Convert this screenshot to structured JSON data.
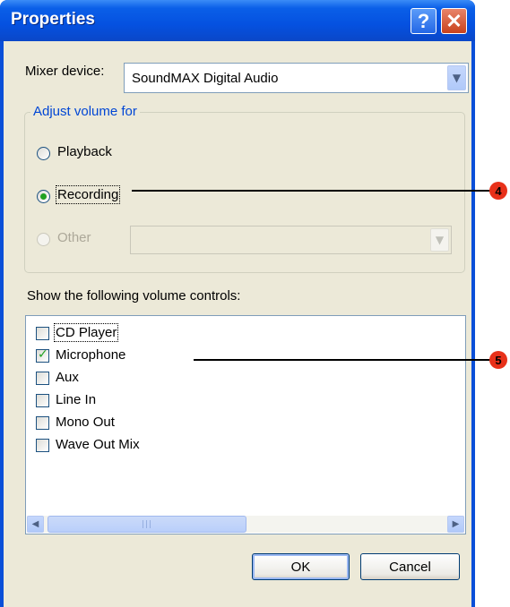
{
  "window": {
    "title": "Properties",
    "help_glyph": "?",
    "close_glyph": "✕"
  },
  "mixer": {
    "label": "Mixer device:",
    "selected": "SoundMAX Digital Audio"
  },
  "adjust_group": {
    "title": "Adjust volume for",
    "options": [
      {
        "label": "Playback",
        "checked": false,
        "enabled": true
      },
      {
        "label": "Recording",
        "checked": true,
        "enabled": true
      },
      {
        "label": "Other",
        "checked": false,
        "enabled": false
      }
    ]
  },
  "controls": {
    "label": "Show the following volume controls:",
    "items": [
      {
        "label": "CD Player",
        "checked": false
      },
      {
        "label": "Microphone",
        "checked": true
      },
      {
        "label": "Aux",
        "checked": false
      },
      {
        "label": "Line In",
        "checked": false
      },
      {
        "label": "Mono Out",
        "checked": false
      },
      {
        "label": "Wave Out Mix",
        "checked": false
      }
    ]
  },
  "buttons": {
    "ok": "OK",
    "cancel": "Cancel"
  },
  "callouts": [
    "4",
    "5"
  ],
  "colors": {
    "titlebar": "#0551e0",
    "dialog_bg": "#ece9d8",
    "group_title": "#0046d5",
    "check_green": "#21a121",
    "callout_red": "#e8311a"
  }
}
